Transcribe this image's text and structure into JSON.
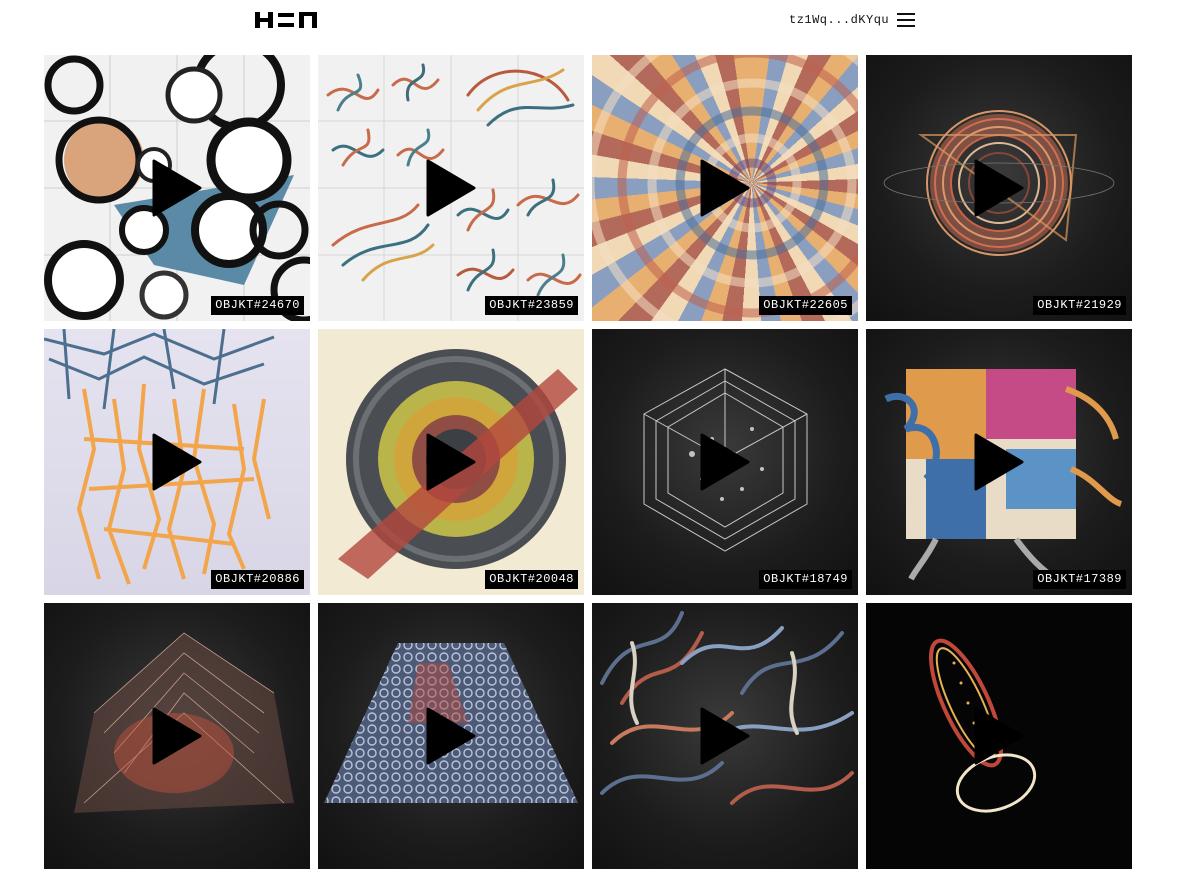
{
  "header": {
    "logo_icon": "hen-logo-icon",
    "wallet_address": "tz1Wq...dKYqu",
    "menu_icon": "hamburger-menu-icon"
  },
  "gallery": {
    "play_icon": "play-icon",
    "items": [
      {
        "label": "OBJKT#24670"
      },
      {
        "label": "OBJKT#23859"
      },
      {
        "label": "OBJKT#22605"
      },
      {
        "label": "OBJKT#21929"
      },
      {
        "label": "OBJKT#20886"
      },
      {
        "label": "OBJKT#20048"
      },
      {
        "label": "OBJKT#18749"
      },
      {
        "label": "OBJKT#17389"
      },
      {
        "label": ""
      },
      {
        "label": ""
      },
      {
        "label": ""
      },
      {
        "label": ""
      }
    ]
  },
  "colors": {
    "background": "#ffffff",
    "label_bg": "#000000",
    "label_text": "#ffffff",
    "play_icon": "#000000"
  }
}
